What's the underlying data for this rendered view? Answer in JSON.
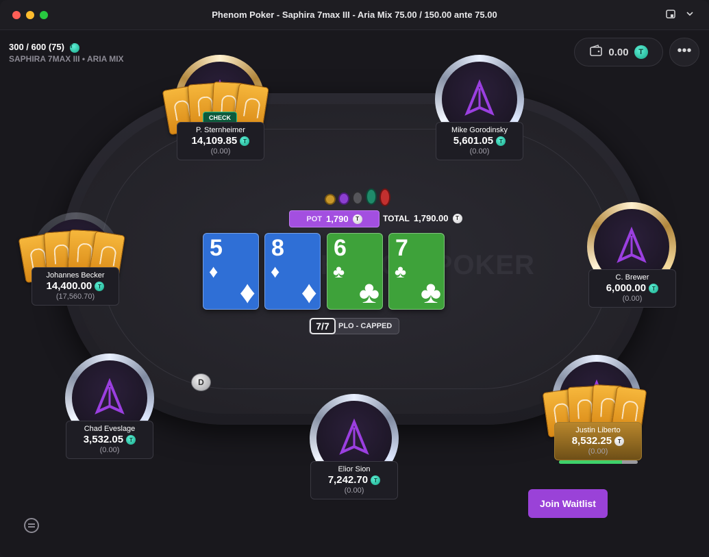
{
  "window": {
    "title": "Phenom Poker - Saphira 7max III - Aria Mix 75.00 / 150.00 ante 75.00"
  },
  "header": {
    "stakes": "300 / 600 (75)",
    "subtitle": "SAPHIRA 7MAX III • ARIA MIX",
    "wallet_balance": "0.00",
    "menu_label": "•••"
  },
  "pot": {
    "pot_label": "POT",
    "pot_value": "1,790",
    "total_label": "TOTAL",
    "total_value": "1,790.00"
  },
  "board": {
    "cards": [
      {
        "rank": "5",
        "suit": "♦",
        "color": "#2f6fd6"
      },
      {
        "rank": "8",
        "suit": "♦",
        "color": "#2f6fd6"
      },
      {
        "rank": "6",
        "suit": "♣",
        "color": "#3ea23a"
      },
      {
        "rank": "7",
        "suit": "♣",
        "color": "#3ea23a"
      }
    ]
  },
  "game": {
    "count": "7/7",
    "name": "PLO - CAPPED"
  },
  "watermark": "PHENOM POKER",
  "dealer_button": "D",
  "action_badge": "CHECK",
  "seats": [
    {
      "name": "P. Sternheimer",
      "stack": "14,109.85",
      "sub": "(0.00)"
    },
    {
      "name": "Mike Gorodinsky",
      "stack": "5,601.05",
      "sub": "(0.00)"
    },
    {
      "name": "Johannes Becker",
      "stack": "14,400.00",
      "sub": "(17,560.70)"
    },
    {
      "name": "C. Brewer",
      "stack": "6,000.00",
      "sub": "(0.00)"
    },
    {
      "name": "Chad Eveslage",
      "stack": "3,532.05",
      "sub": "(0.00)"
    },
    {
      "name": "Elior Sion",
      "stack": "7,242.70",
      "sub": "(0.00)"
    },
    {
      "name": "Justin Liberto",
      "stack": "8,532.25",
      "sub": "(0.00)"
    }
  ],
  "timer_progress": 0.8,
  "join_button": "Join Waitlist",
  "colors": {
    "accent_purple": "#9a42d8",
    "pot_purple": "#a34fe0",
    "card_blue": "#2f6fd6",
    "card_green": "#3ea23a",
    "card_back_orange": "#f0a22a",
    "gem_teal": "#2fd3b0"
  },
  "icons": [
    "gem-icon",
    "wallet-icon",
    "more-icon",
    "chat-icon",
    "window-icon"
  ]
}
